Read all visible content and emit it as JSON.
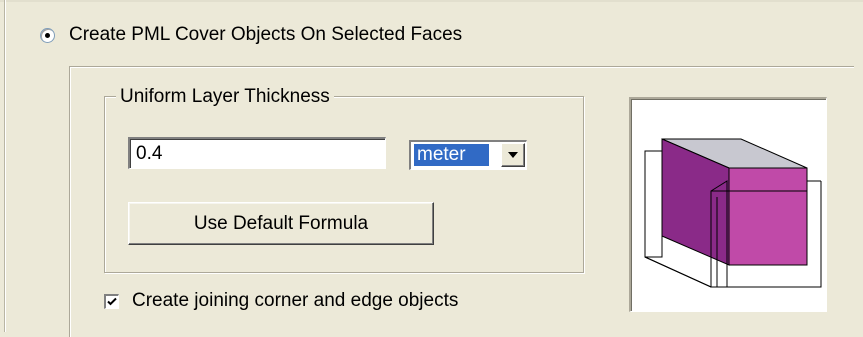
{
  "options": {
    "cover_mode_label": "Create PML Cover Objects On Selected Faces",
    "cover_mode_selected": true
  },
  "thickness": {
    "group_title": "Uniform Layer Thickness",
    "value": "0.4",
    "unit_selected": "meter",
    "default_formula_button": "Use Default Formula"
  },
  "joining": {
    "label": "Create joining corner and edge objects",
    "checked": true
  },
  "preview": {
    "icon": "pml-cube-preview-icon",
    "colors": {
      "top_face": "#c8c8d0",
      "front_face": "#c04aa8",
      "side_face": "#8a2a88"
    }
  }
}
